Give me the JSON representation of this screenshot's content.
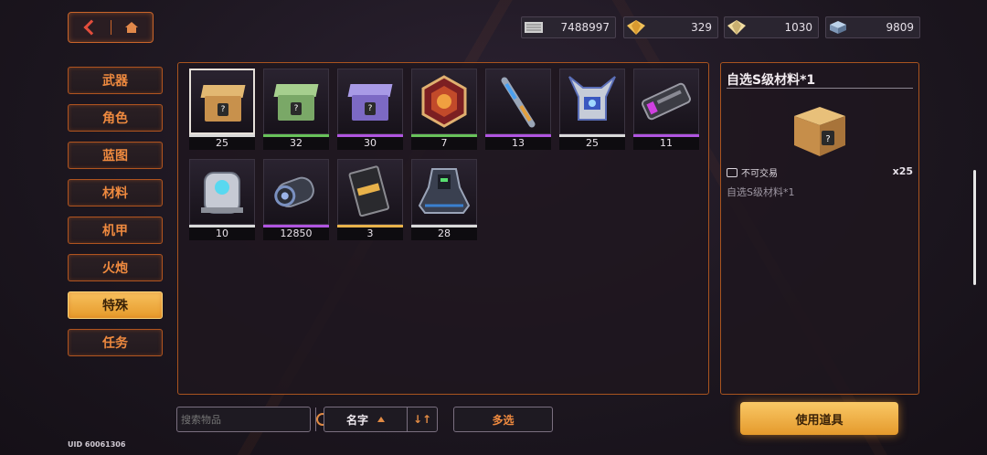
{
  "nav": {
    "back_icon": "back-arrow-icon",
    "home_icon": "home-icon"
  },
  "currencies": [
    {
      "icon": "coin-icon",
      "value": "7488997"
    },
    {
      "icon": "gold-gem-icon",
      "value": "329"
    },
    {
      "icon": "silver-gem-icon",
      "value": "1030"
    },
    {
      "icon": "crystal-icon",
      "value": "9809"
    }
  ],
  "tabs": [
    "武器",
    "角色",
    "蓝图",
    "材料",
    "机甲",
    "火炮",
    "特殊",
    "任务"
  ],
  "active_tab": "特殊",
  "items": [
    {
      "icon": "cardboard-box-icon",
      "rarity": "white",
      "count": "25",
      "selected": true
    },
    {
      "icon": "green-box-icon",
      "rarity": "green",
      "count": "32"
    },
    {
      "icon": "purple-box-icon",
      "rarity": "purple",
      "count": "30"
    },
    {
      "icon": "hexagon-badge-icon",
      "rarity": "green",
      "count": "7"
    },
    {
      "icon": "syringe-tool-icon",
      "rarity": "purple",
      "count": "13"
    },
    {
      "icon": "mech-head-icon",
      "rarity": "white",
      "count": "25"
    },
    {
      "icon": "device-icon",
      "rarity": "purple",
      "count": "11"
    },
    {
      "icon": "robot-icon",
      "rarity": "white",
      "count": "10"
    },
    {
      "icon": "reactor-core-icon",
      "rarity": "purple",
      "count": "12850"
    },
    {
      "icon": "gold-card-icon",
      "rarity": "gold",
      "count": "3"
    },
    {
      "icon": "armor-suit-icon",
      "rarity": "white",
      "count": "28"
    }
  ],
  "detail": {
    "title": "自选S级材料*1",
    "trade": "不可交易",
    "quantity": "x25",
    "description": "自选S级材料*1"
  },
  "search": {
    "placeholder": "搜索物品"
  },
  "sort": {
    "label": "名字",
    "order_icon": "sort-order-icon"
  },
  "multi_select": "多选",
  "use_button": "使用道具",
  "uid": "UID 60061306",
  "colors": {
    "accent": "#ef8a3f",
    "border": "#a9541f",
    "active_tab": "#f0b34a"
  }
}
